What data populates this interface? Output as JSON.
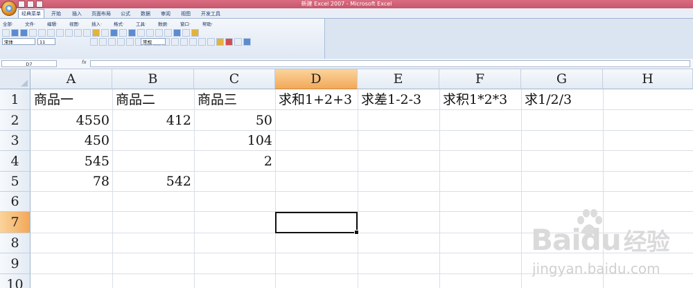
{
  "window": {
    "title": "新建 Excel 2007 - Microsoft Excel"
  },
  "ribbon_tabs": [
    "经典菜单",
    "开始",
    "插入",
    "页面布局",
    "公式",
    "数据",
    "审阅",
    "视图",
    "开发工具"
  ],
  "menu": [
    "全部·",
    "文件·",
    "编辑·",
    "视图·",
    "插入·",
    "格式·",
    "工具·",
    "数据·",
    "窗口·",
    "帮助·"
  ],
  "toolbar": {
    "font": "宋体",
    "size": "11",
    "style": "常规"
  },
  "formula_bar": {
    "name_box": "D7",
    "fx": "fx",
    "content": ""
  },
  "columns": [
    "A",
    "B",
    "C",
    "D",
    "E",
    "F",
    "G",
    "H"
  ],
  "rows": [
    "1",
    "2",
    "3",
    "4",
    "5",
    "6",
    "7",
    "8",
    "9",
    "10"
  ],
  "cells": {
    "A1": "商品一",
    "B1": "商品二",
    "C1": "商品三",
    "D1": "求和1+2+3",
    "E1": "求差1-2-3",
    "F1": "求积1*2*3",
    "G1": "求1/2/3",
    "A2": "4550",
    "B2": "412",
    "C2": "50",
    "A3": "450",
    "C3": "104",
    "A4": "545",
    "C4": "2",
    "A5": "78",
    "B5": "542"
  },
  "selection": {
    "active_cell": "D7",
    "selected_column": "D",
    "selected_row": "7"
  },
  "watermark": {
    "brand": "Baidu",
    "logo_text": "经验",
    "url": "jingyan.baidu.com"
  }
}
